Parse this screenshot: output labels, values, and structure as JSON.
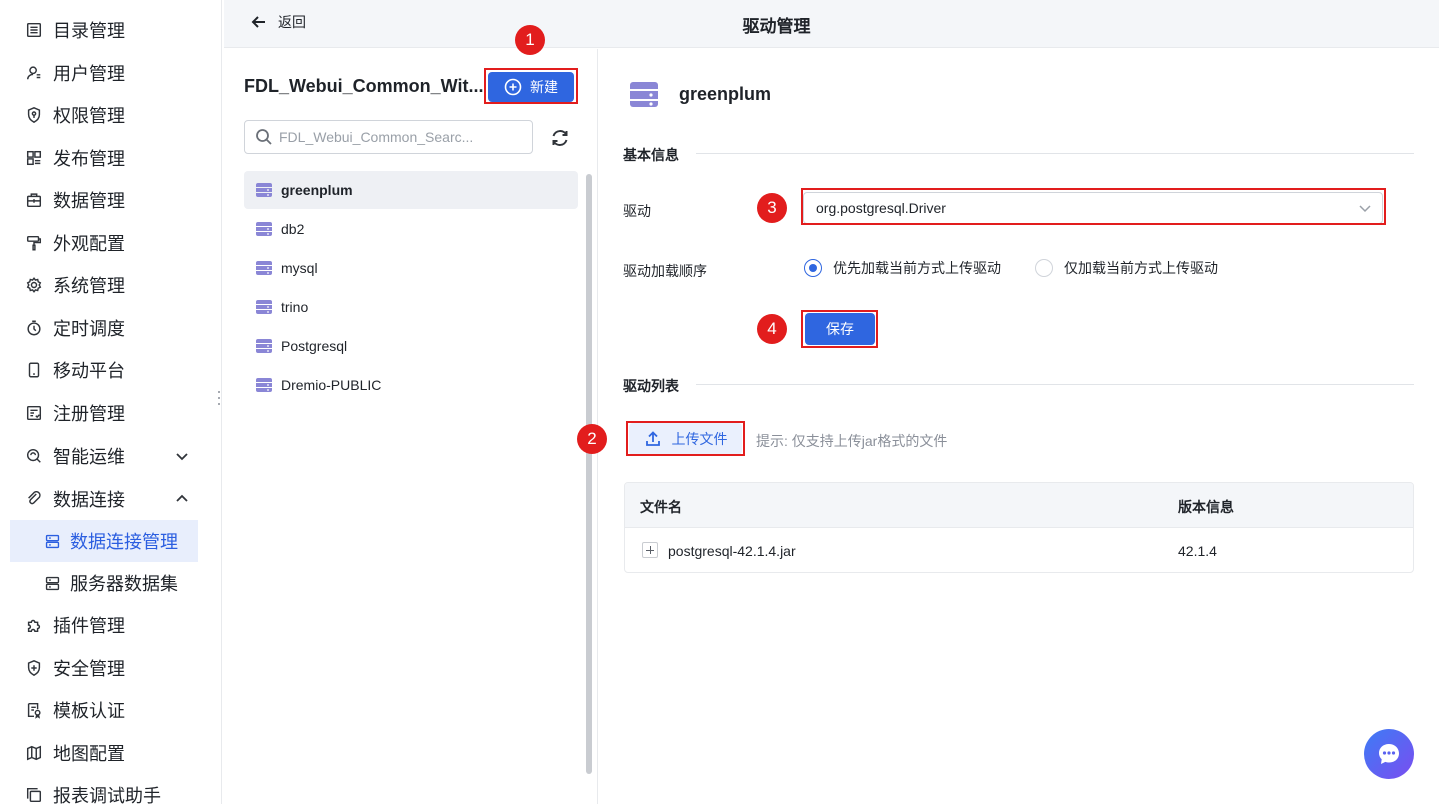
{
  "nav": {
    "items": [
      {
        "label": "目录管理",
        "icon": "list-icon"
      },
      {
        "label": "用户管理",
        "icon": "user-icon"
      },
      {
        "label": "权限管理",
        "icon": "shield-lock-icon"
      },
      {
        "label": "发布管理",
        "icon": "publish-icon"
      },
      {
        "label": "数据管理",
        "icon": "briefcase-icon"
      },
      {
        "label": "外观配置",
        "icon": "paint-roller-icon"
      },
      {
        "label": "系统管理",
        "icon": "gear-icon"
      },
      {
        "label": "定时调度",
        "icon": "stopwatch-icon"
      },
      {
        "label": "移动平台",
        "icon": "mobile-icon"
      },
      {
        "label": "注册管理",
        "icon": "register-icon"
      },
      {
        "label": "智能运维",
        "icon": "ops-icon"
      },
      {
        "label": "数据连接",
        "icon": "link-icon"
      },
      {
        "label": "插件管理",
        "icon": "puzzle-icon"
      },
      {
        "label": "安全管理",
        "icon": "shield-plus-icon"
      },
      {
        "label": "模板认证",
        "icon": "certificate-icon"
      },
      {
        "label": "地图配置",
        "icon": "map-icon"
      },
      {
        "label": "报表调试助手",
        "icon": "copy-icon"
      }
    ],
    "sub_items": [
      {
        "label": "数据连接管理",
        "icon": "server-icon",
        "active": true
      },
      {
        "label": "服务器数据集",
        "icon": "server-icon",
        "active": false
      }
    ]
  },
  "header": {
    "back_label": "返回",
    "title": "驱动管理"
  },
  "list_panel": {
    "title": "FDL_Webui_Common_Wit...",
    "new_label": "新建",
    "search_placeholder": "FDL_Webui_Common_Searc...",
    "items": [
      "greenplum",
      "db2",
      "mysql",
      "trino",
      "Postgresql",
      "Dremio-PUBLIC"
    ],
    "selected": "greenplum"
  },
  "detail": {
    "name": "greenplum",
    "basic_section": "基本信息",
    "driver_label": "驱动",
    "driver_value": "org.postgresql.Driver",
    "load_order_label": "驱动加载顺序",
    "load_options": [
      "优先加载当前方式上传驱动",
      "仅加载当前方式上传驱动"
    ],
    "load_selected": "优先加载当前方式上传驱动",
    "save_label": "保存",
    "list_section": "驱动列表",
    "upload_label": "上传文件",
    "upload_tip": "提示: 仅支持上传jar格式的文件",
    "table": {
      "columns": [
        "文件名",
        "版本信息"
      ],
      "rows": [
        {
          "file": "postgresql-42.1.4.jar",
          "version": "42.1.4"
        }
      ]
    }
  },
  "annotations": [
    "1",
    "2",
    "3",
    "4"
  ],
  "colors": {
    "primary": "#2f66e0",
    "annotation": "#e21d1d",
    "active_nav_bg": "#e8eefc"
  }
}
